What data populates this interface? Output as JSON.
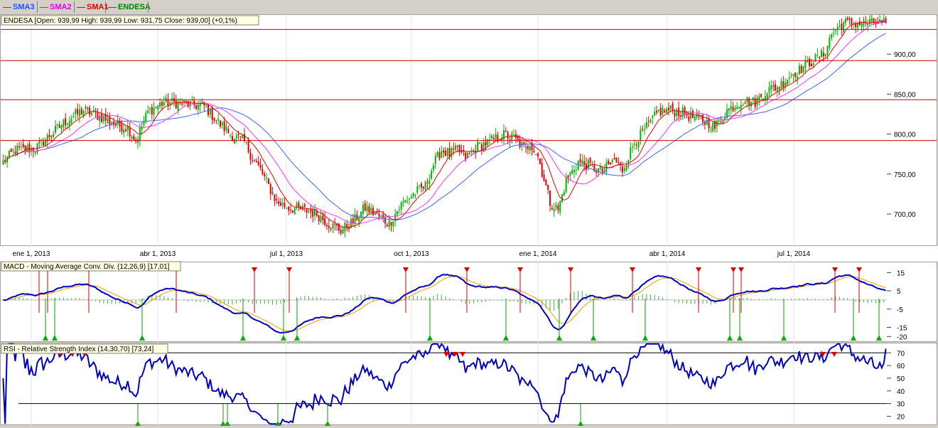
{
  "legend": [
    {
      "label": "SMA3",
      "color": "#1e50ff"
    },
    {
      "label": "SMA2",
      "color": "#e800e8"
    },
    {
      "label": "SMA1",
      "color": "#e00000"
    },
    {
      "label": "ENDESA",
      "color": "#008000"
    }
  ],
  "colors": {
    "sma3": "#3a66ff",
    "sma2": "#ff33ff",
    "sma1": "#ee0000",
    "up": "#00b400",
    "down": "#e00000",
    "macd": "#0000c0",
    "signal": "#f0a000",
    "hist": "#3cb43c",
    "rsi": "#0000c0",
    "arrow_up": "#00b000",
    "arrow_down": "#e00000"
  },
  "chart_data": [
    {
      "type": "candlestick",
      "title": "ENDESA [Open: 939,99  High: 939,99  Low: 931,75  Close: 939,00] (+0,1%)",
      "x_ticks": [
        "ene 1, 2013",
        "abr 1, 2013",
        "jul 1, 2013",
        "oct 1, 2013",
        "ene 1, 2014",
        "abr 1, 2014",
        "jul 1, 2014"
      ],
      "y_ticks": [
        "700,00",
        "750,00",
        "800,00",
        "850,00",
        "900,00"
      ],
      "ylim": [
        660,
        950
      ],
      "horizontal_lines": [
        792,
        843,
        892,
        931
      ],
      "close_series": [
        [
          0,
          765
        ],
        [
          3,
          780
        ],
        [
          8,
          782
        ],
        [
          12,
          800
        ],
        [
          16,
          818
        ],
        [
          20,
          830
        ],
        [
          24,
          822
        ],
        [
          28,
          812
        ],
        [
          31,
          808
        ],
        [
          33,
          792
        ],
        [
          36,
          828
        ],
        [
          40,
          840
        ],
        [
          45,
          838
        ],
        [
          50,
          835
        ],
        [
          54,
          812
        ],
        [
          57,
          798
        ],
        [
          60,
          790
        ],
        [
          62,
          770
        ],
        [
          64,
          755
        ],
        [
          66,
          735
        ],
        [
          68,
          715
        ],
        [
          71,
          708
        ],
        [
          75,
          705
        ],
        [
          78,
          700
        ],
        [
          81,
          688
        ],
        [
          84,
          680
        ],
        [
          87,
          690
        ],
        [
          90,
          708
        ],
        [
          93,
          698
        ],
        [
          96,
          688
        ],
        [
          99,
          712
        ],
        [
          102,
          725
        ],
        [
          105,
          735
        ],
        [
          107,
          762
        ],
        [
          109,
          780
        ],
        [
          111,
          775
        ],
        [
          113,
          780
        ],
        [
          115,
          770
        ],
        [
          118,
          785
        ],
        [
          121,
          790
        ],
        [
          124,
          800
        ],
        [
          127,
          795
        ],
        [
          130,
          780
        ],
        [
          131,
          790
        ],
        [
          133,
          772
        ],
        [
          136,
          715
        ],
        [
          138,
          705
        ],
        [
          140,
          742
        ],
        [
          143,
          765
        ],
        [
          146,
          760
        ],
        [
          149,
          752
        ],
        [
          152,
          768
        ],
        [
          154,
          755
        ],
        [
          157,
          790
        ],
        [
          160,
          808
        ],
        [
          163,
          828
        ],
        [
          166,
          830
        ],
        [
          169,
          826
        ],
        [
          172,
          820
        ],
        [
          175,
          815
        ],
        [
          177,
          808
        ],
        [
          180,
          830
        ],
        [
          184,
          842
        ],
        [
          187,
          840
        ],
        [
          190,
          855
        ],
        [
          193,
          860
        ],
        [
          196,
          875
        ],
        [
          198,
          880
        ],
        [
          200,
          888
        ],
        [
          204,
          900
        ],
        [
          206,
          925
        ],
        [
          208,
          935
        ],
        [
          209,
          939
        ]
      ]
    },
    {
      "type": "line",
      "title": "MACD - Moving Average Conv. Div. (12,26,9) [17,01]",
      "y_ticks": [
        "15",
        "5",
        "-5",
        "-15",
        "-20"
      ],
      "ylim": [
        -23,
        21
      ]
    },
    {
      "type": "line",
      "title": "RSI - Relative Strength Index (14,30,70) [73,24]",
      "y_ticks": [
        "70",
        "60",
        "50",
        "40",
        "30",
        "20"
      ],
      "ylim": [
        13,
        78
      ],
      "levels": [
        30,
        70
      ]
    }
  ]
}
